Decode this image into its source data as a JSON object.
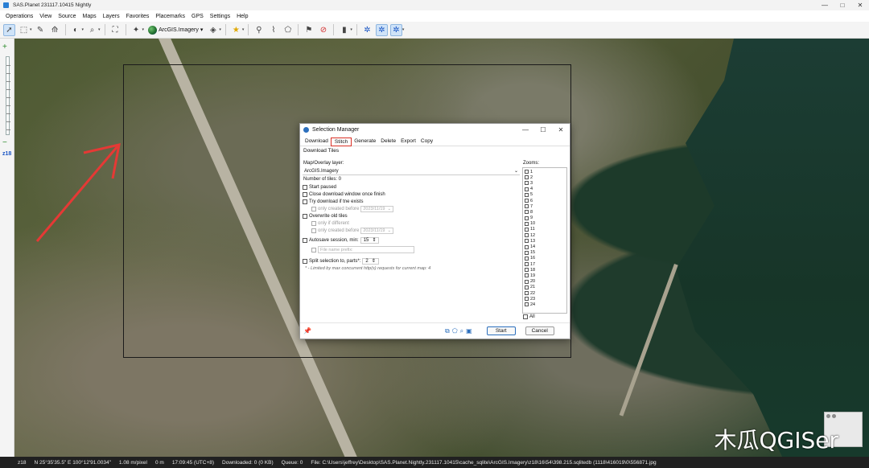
{
  "window": {
    "title": "SAS.Planet 231117.10415 Nightly",
    "controls": [
      "—",
      "□",
      "✕"
    ]
  },
  "menu": [
    "Operations",
    "View",
    "Source",
    "Maps",
    "Layers",
    "Favorites",
    "Placemarks",
    "GPS",
    "Settings",
    "Help"
  ],
  "toolbar": {
    "map_label": "ArcGIS.Imagery"
  },
  "zoombar": {
    "level": "z18",
    "plus": "+",
    "minus": "−"
  },
  "watermark": "木瓜QGISer",
  "status": {
    "zoom": "z18",
    "coords": "N 25°35'35.5\" E 100°12'91.0034\"",
    "scale": "1.08 m/pixel",
    "dist": "0 m",
    "time": "17:09:45 (UTC+8)",
    "download": "Downloaded: 0 (0 KB)",
    "queue": "Queue: 0",
    "file": "File: C:\\Users\\jeffrey\\Desktop\\SAS.Planet.Nightly.231117.10415\\cache_sqlite\\ArcGIS.Imagery\\z18\\16\\54\\398.215.sqlitedb (1118\\416019\\0\\556871.jpg"
  },
  "dialog": {
    "title": "Selection Manager",
    "title_buttons": [
      "—",
      "☐",
      "✕"
    ],
    "tabs": [
      "Download",
      "Stitch",
      "Generate",
      "Delete",
      "Export",
      "Copy"
    ],
    "section": "Download Tiles",
    "layer_label": "Map/Overlay layer:",
    "layer_value": "ArcGIS.Imagery",
    "tiles_label": "Number of tiles: 0",
    "options": {
      "start_paused": "Start paused",
      "close_window": "Close download window once finish",
      "try_download": "Try download if tne exists",
      "only_created_1": "only created before",
      "date_1": "2023/11/19",
      "overwrite": "Overwrite old tiles",
      "only_if_different": "only if different",
      "only_created_2": "only created before",
      "date_2": "2023/11/19",
      "autosave": "Autosave session, min:",
      "autosave_value": "15",
      "prefix_label": "File name prefix:",
      "split": "Split selection to, parts*:",
      "split_value": "2",
      "note": "* - Limited by max concurrent http(s) requests for current map: 4"
    },
    "zooms_label": "Zooms:",
    "zooms": [
      "1",
      "2",
      "3",
      "4",
      "5",
      "6",
      "7",
      "8",
      "9",
      "10",
      "11",
      "12",
      "13",
      "14",
      "15",
      "16",
      "17",
      "18",
      "19",
      "20",
      "21",
      "22",
      "23",
      "24"
    ],
    "all_label": "All",
    "buttons": {
      "start": "Start",
      "cancel": "Cancel"
    }
  }
}
